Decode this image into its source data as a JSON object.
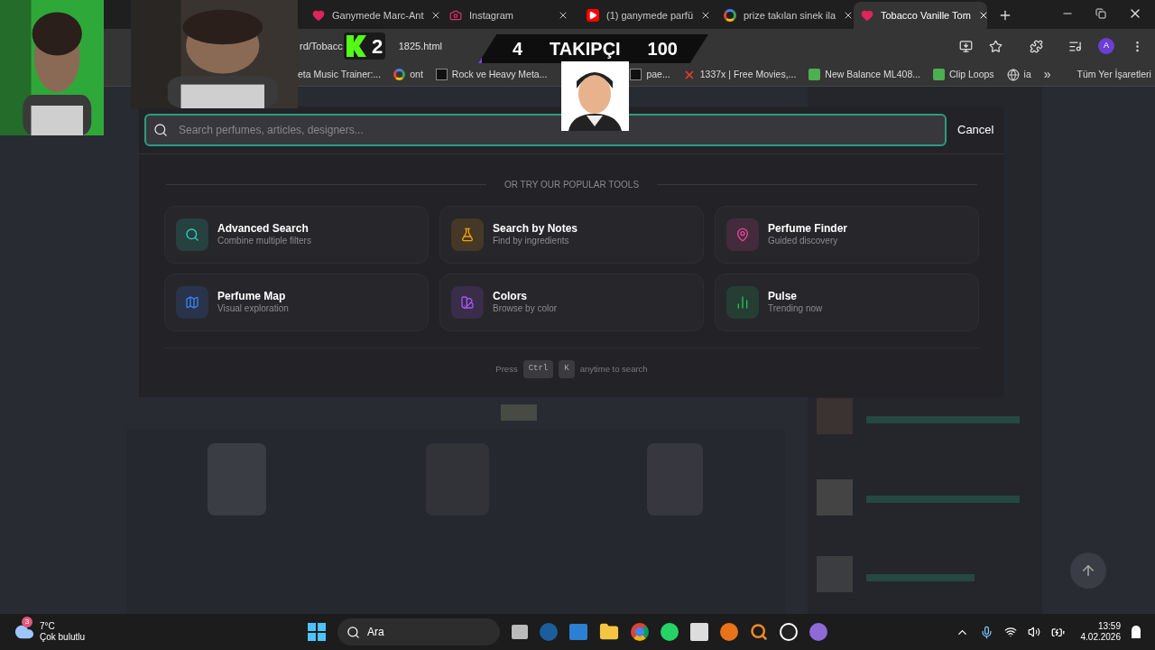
{
  "browser": {
    "tabs": [
      {
        "title": "Ganymede Marc-Ant",
        "selected": false,
        "kind": "heart"
      },
      {
        "title": "Instagram",
        "selected": false,
        "kind": "camera"
      },
      {
        "title": "(1) ganymede parfü",
        "selected": false,
        "kind": "video"
      },
      {
        "title": "prize takılan sinek ila",
        "selected": false,
        "kind": "google"
      },
      {
        "title": "Tobacco Vanille Tom",
        "selected": true,
        "kind": "heart"
      }
    ],
    "url_parts": [
      "rd/Tobacc",
      "1825.html"
    ],
    "bookmarks": [
      {
        "title": "eta Music Trainer:...",
        "kind": "none"
      },
      {
        "title": "ont",
        "kind": "google"
      },
      {
        "title": "Rock ve Heavy Meta...",
        "kind": "square"
      },
      {
        "title": "pae...",
        "kind": "square"
      },
      {
        "title": "1337x | Free Movies,...",
        "kind": "cross"
      },
      {
        "title": "New Balance ML408...",
        "kind": "tile"
      },
      {
        "title": "Clip Loops",
        "kind": "tile"
      },
      {
        "title": "ia",
        "kind": "globe"
      }
    ],
    "bookmarks_more": "»",
    "all_bookmarks": "Tüm Yer İşaretleri",
    "profile_initial": "A"
  },
  "stream_overlay": {
    "counter": "2",
    "follower_current": "4",
    "follower_label": "TAKIPÇI",
    "follower_goal": "100"
  },
  "search_modal": {
    "placeholder": "Search perfumes, articles, designers...",
    "cancel": "Cancel",
    "section_title": "OR TRY OUR POPULAR TOOLS",
    "tools": [
      {
        "title": "Advanced Search",
        "subtitle": "Combine multiple filters",
        "kind": "search",
        "color": "#2dd4bf"
      },
      {
        "title": "Search by Notes",
        "subtitle": "Find by ingredients",
        "kind": "flask",
        "color": "#f59e0b"
      },
      {
        "title": "Perfume Finder",
        "subtitle": "Guided discovery",
        "kind": "pin",
        "color": "#ec4899"
      },
      {
        "title": "Perfume Map",
        "subtitle": "Visual exploration",
        "kind": "map",
        "color": "#3b82f6"
      },
      {
        "title": "Colors",
        "subtitle": "Browse by color",
        "kind": "palette",
        "color": "#a855f7"
      },
      {
        "title": "Pulse",
        "subtitle": "Trending now",
        "kind": "chart",
        "color": "#22c55e"
      }
    ],
    "hint": {
      "before": "Press",
      "keys": [
        "Ctrl",
        "K"
      ],
      "after": "anytime to search"
    }
  },
  "taskbar": {
    "weather": {
      "badge": "3",
      "temp": "7°C",
      "condition": "Çok bulutlu"
    },
    "search": "Ara",
    "time": "13:59",
    "date": "4.02.2026"
  }
}
